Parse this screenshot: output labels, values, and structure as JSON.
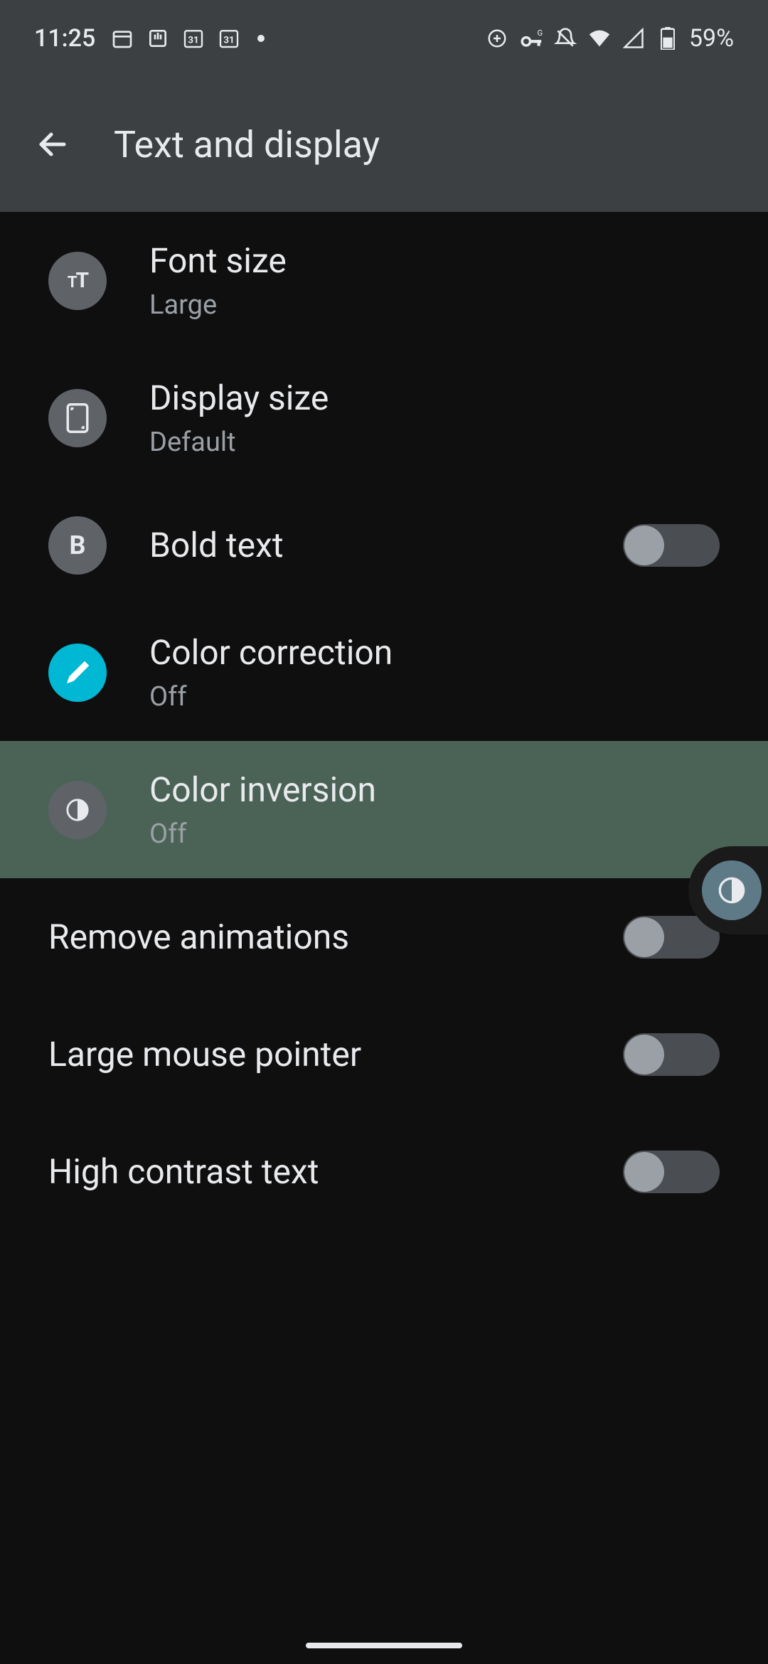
{
  "status": {
    "time": "11:25",
    "battery": "59%"
  },
  "header": {
    "title": "Text and display"
  },
  "settings": {
    "font_size": {
      "title": "Font size",
      "subtitle": "Large"
    },
    "display_size": {
      "title": "Display size",
      "subtitle": "Default"
    },
    "bold_text": {
      "title": "Bold text"
    },
    "color_correction": {
      "title": "Color correction",
      "subtitle": "Off"
    },
    "color_inversion": {
      "title": "Color inversion",
      "subtitle": "Off"
    },
    "remove_animations": {
      "title": "Remove animations"
    },
    "large_mouse_pointer": {
      "title": "Large mouse pointer"
    },
    "high_contrast_text": {
      "title": "High contrast text"
    }
  }
}
